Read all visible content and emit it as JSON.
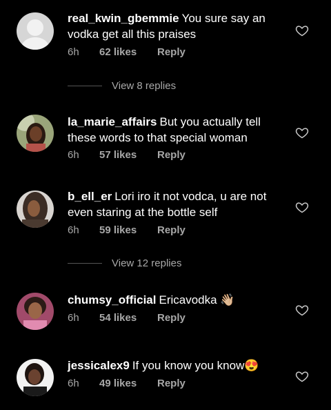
{
  "comments": [
    {
      "username": "real_kwin_gbemmie",
      "text": "You sure say an vodka get all this praises",
      "time": "6h",
      "likes": "62 likes",
      "reply": "Reply",
      "emoji": ""
    },
    {
      "username": "la_marie_affairs",
      "text": "But you actually tell these words to that special woman",
      "time": "6h",
      "likes": "57 likes",
      "reply": "Reply",
      "emoji": ""
    },
    {
      "username": "b_ell_er",
      "text": "Lori iro it not vodca,  u are not even staring at the bottle self",
      "time": "6h",
      "likes": "59 likes",
      "reply": "Reply",
      "emoji": ""
    },
    {
      "username": "chumsy_official",
      "text": "Ericavodka",
      "time": "6h",
      "likes": "54 likes",
      "reply": "Reply",
      "emoji": "👋🏼"
    },
    {
      "username": "jessicalex9",
      "text": "If you know you know",
      "time": "6h",
      "likes": "49 likes",
      "reply": "Reply",
      "emoji": "😍"
    }
  ],
  "replies": [
    {
      "label": "View 8 replies"
    },
    {
      "label": "View 12 replies"
    }
  ],
  "colors": {
    "background": "#000000",
    "muted": "#a8a8a8"
  }
}
